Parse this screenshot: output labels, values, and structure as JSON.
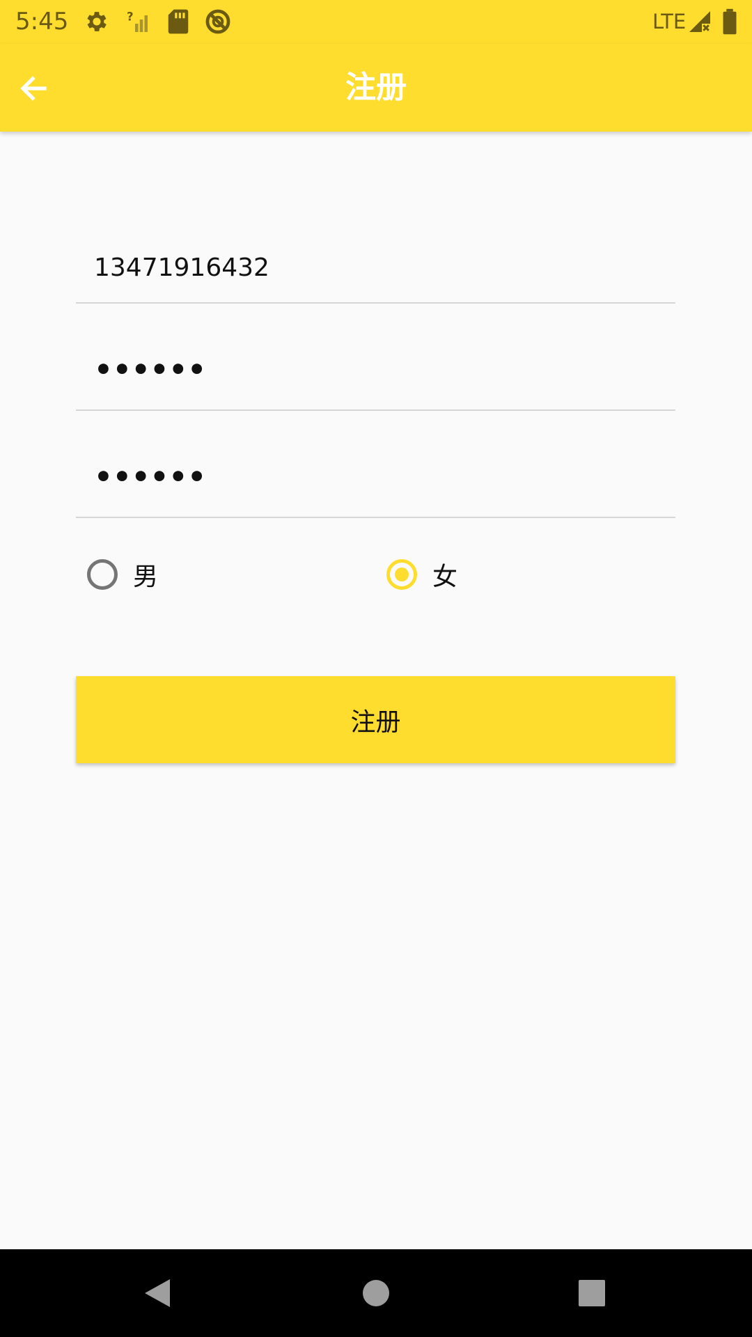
{
  "status_bar": {
    "time": "5:45",
    "network": "LTE",
    "icons": [
      "gear-icon",
      "signal-unknown-icon",
      "sd-card-icon",
      "blocked-icon",
      "signal-x-icon",
      "battery-icon"
    ]
  },
  "app_bar": {
    "title": "注册",
    "back_icon": "arrow-left-icon"
  },
  "form": {
    "phone_value": "13471916432",
    "password_value": "••••••",
    "confirm_password_value": "••••••",
    "gender_options": [
      {
        "label": "男",
        "selected": false
      },
      {
        "label": "女",
        "selected": true
      }
    ],
    "submit_label": "注册"
  },
  "nav_bar": {
    "icons": [
      "back-triangle-icon",
      "home-circle-icon",
      "recents-square-icon"
    ]
  },
  "colors": {
    "accent": "#FFDD2E",
    "background": "#FAFAFA",
    "status_text": "#6B5A12",
    "radio_unselected": "#757575"
  }
}
